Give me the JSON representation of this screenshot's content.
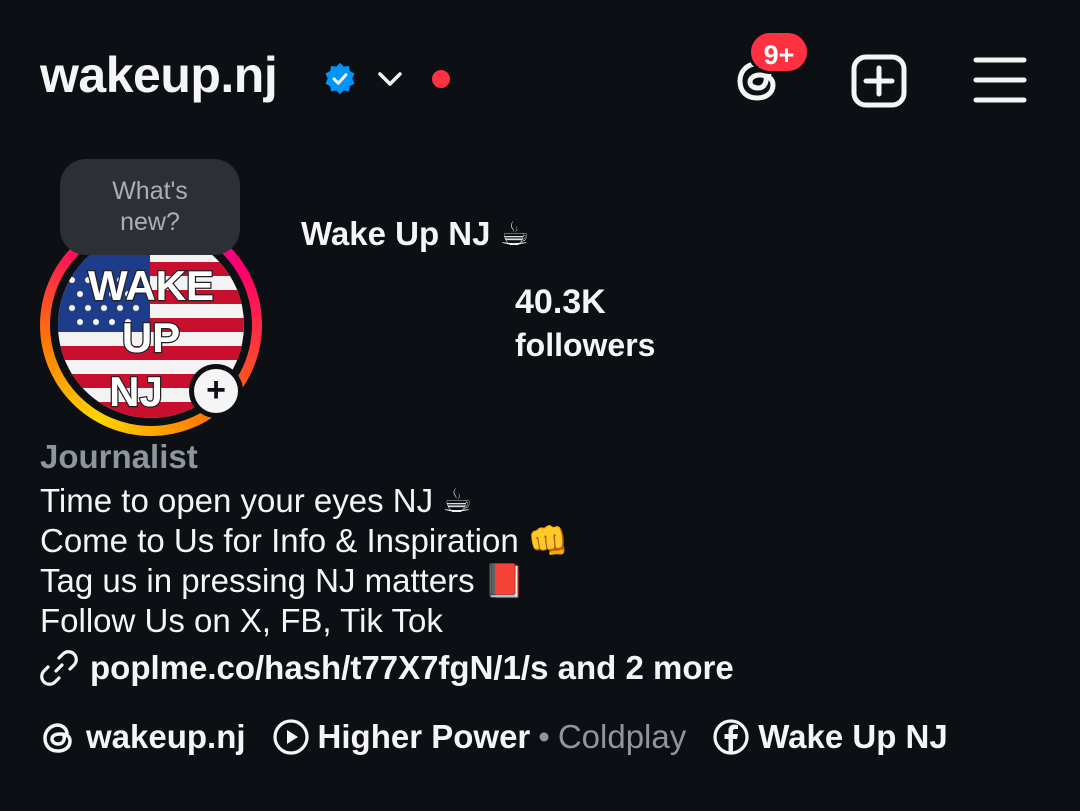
{
  "header": {
    "username": "wakeup.nj",
    "verified_icon": "verified-badge-icon",
    "notification_badge": "9+"
  },
  "avatar_tooltip": {
    "line1": "What's",
    "line2": "new?"
  },
  "avatar": {
    "logo_text": [
      "WAKE",
      "UP",
      "NJ"
    ]
  },
  "profile": {
    "display_name": "Wake Up NJ ☕",
    "followers_count": "40.3K",
    "followers_label": "followers",
    "category": "Journalist",
    "bio": [
      "Time to open your eyes NJ ☕",
      "Come to Us for Info & Inspiration 👊",
      "Tag us in pressing NJ matters 📕",
      "Follow Us on X, FB, Tik Tok"
    ],
    "link": "poplme.co/hash/t77X7fgN/1/s and 2 more"
  },
  "chips": {
    "threads": "wakeup.nj",
    "music_title": "Higher Power",
    "music_separator": "•",
    "music_artist": "Coldplay",
    "facebook": "Wake Up NJ"
  },
  "colors": {
    "background": "#0c1014",
    "text": "#f5f5f5",
    "secondary": "#8e959e",
    "notification": "#ff3040",
    "verified": "#0095f6"
  }
}
